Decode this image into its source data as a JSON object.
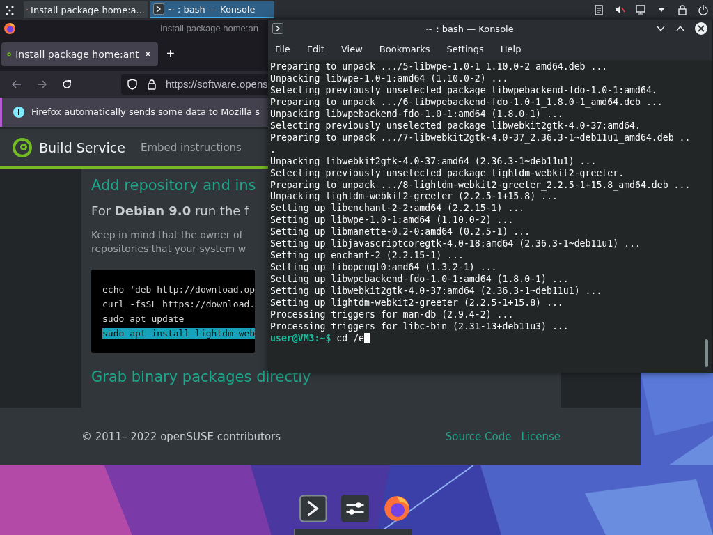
{
  "taskbar": {
    "tasks": [
      {
        "label": "Install package home:a...",
        "kind": "browser",
        "selected": false
      },
      {
        "label": "~ : bash — Konsole",
        "kind": "terminal",
        "selected": true
      }
    ]
  },
  "browser": {
    "window_title": "Install package home:an",
    "tab": {
      "label": "Install package home:ant",
      "close": "×",
      "selected": true
    },
    "new_tab": "+",
    "url": "https://software.opens",
    "notice": "Firefox automatically sends some data to Mozilla s",
    "site": {
      "brand": "Build Service",
      "nav": [
        "Embed instructions"
      ]
    },
    "content": {
      "heading": "Add repository and ins",
      "intro": "For **Debian 9.0** run the f",
      "note": [
        "Keep in mind that the owner of",
        "repositories that your system w"
      ],
      "code": [
        {
          "text": "echo 'deb http://download.op",
          "selected": false
        },
        {
          "text": "curl -fsSL https://download.",
          "selected": false
        },
        {
          "text": "sudo apt update",
          "selected": false
        },
        {
          "text": "sudo apt install lightdm-web",
          "selected": true
        }
      ],
      "heading2": "Grab binary packages directly"
    },
    "footer": {
      "copyright": "© 2011– 2022 openSUSE contributors",
      "links": [
        "Source Code",
        "License"
      ]
    }
  },
  "terminal": {
    "title": "~ : bash — Konsole",
    "menu": [
      "File",
      "Edit",
      "View",
      "Bookmarks",
      "Settings",
      "Help"
    ],
    "lines": [
      "Preparing to unpack .../5-libwpe-1.0-1_1.10.0-2_amd64.deb ...",
      "Unpacking libwpe-1.0-1:amd64 (1.10.0-2) ...",
      "Selecting previously unselected package libwpebackend-fdo-1.0-1:amd64.",
      "Preparing to unpack .../6-libwpebackend-fdo-1.0-1_1.8.0-1_amd64.deb ...",
      "Unpacking libwpebackend-fdo-1.0-1:amd64 (1.8.0-1) ...",
      "Selecting previously unselected package libwebkit2gtk-4.0-37:amd64.",
      "Preparing to unpack .../7-libwebkit2gtk-4.0-37_2.36.3-1~deb11u1_amd64.deb ..",
      ".",
      "Unpacking libwebkit2gtk-4.0-37:amd64 (2.36.3-1~deb11u1) ...",
      "Selecting previously unselected package lightdm-webkit2-greeter.",
      "Preparing to unpack .../8-lightdm-webkit2-greeter_2.2.5-1+15.8_amd64.deb ...",
      "Unpacking lightdm-webkit2-greeter (2.2.5-1+15.8) ...",
      "Setting up libenchant-2-2:amd64 (2.2.15-1) ...",
      "Setting up libwpe-1.0-1:amd64 (1.10.0-2) ...",
      "Setting up libmanette-0.2-0:amd64 (0.2.5-1) ...",
      "Setting up libjavascriptcoregtk-4.0-18:amd64 (2.36.3-1~deb11u1) ...",
      "Setting up enchant-2 (2.2.15-1) ...",
      "Setting up libopengl0:amd64 (1.3.2-1) ...",
      "Setting up libwpebackend-fdo-1.0-1:amd64 (1.8.0-1) ...",
      "Setting up libwebkit2gtk-4.0-37:amd64 (2.36.3-1~deb11u1) ...",
      "Setting up lightdm-webkit2-greeter (2.2.5-1+15.8) ...",
      "Processing triggers for man-db (2.9.4-2) ...",
      "Processing triggers for libc-bin (2.31-13+deb11u3) ..."
    ],
    "prompt": "user@VM3:~$",
    "command": "cd /e"
  },
  "dock": [
    {
      "kind": "terminal"
    },
    {
      "kind": "settings"
    },
    {
      "kind": "browser"
    }
  ]
}
